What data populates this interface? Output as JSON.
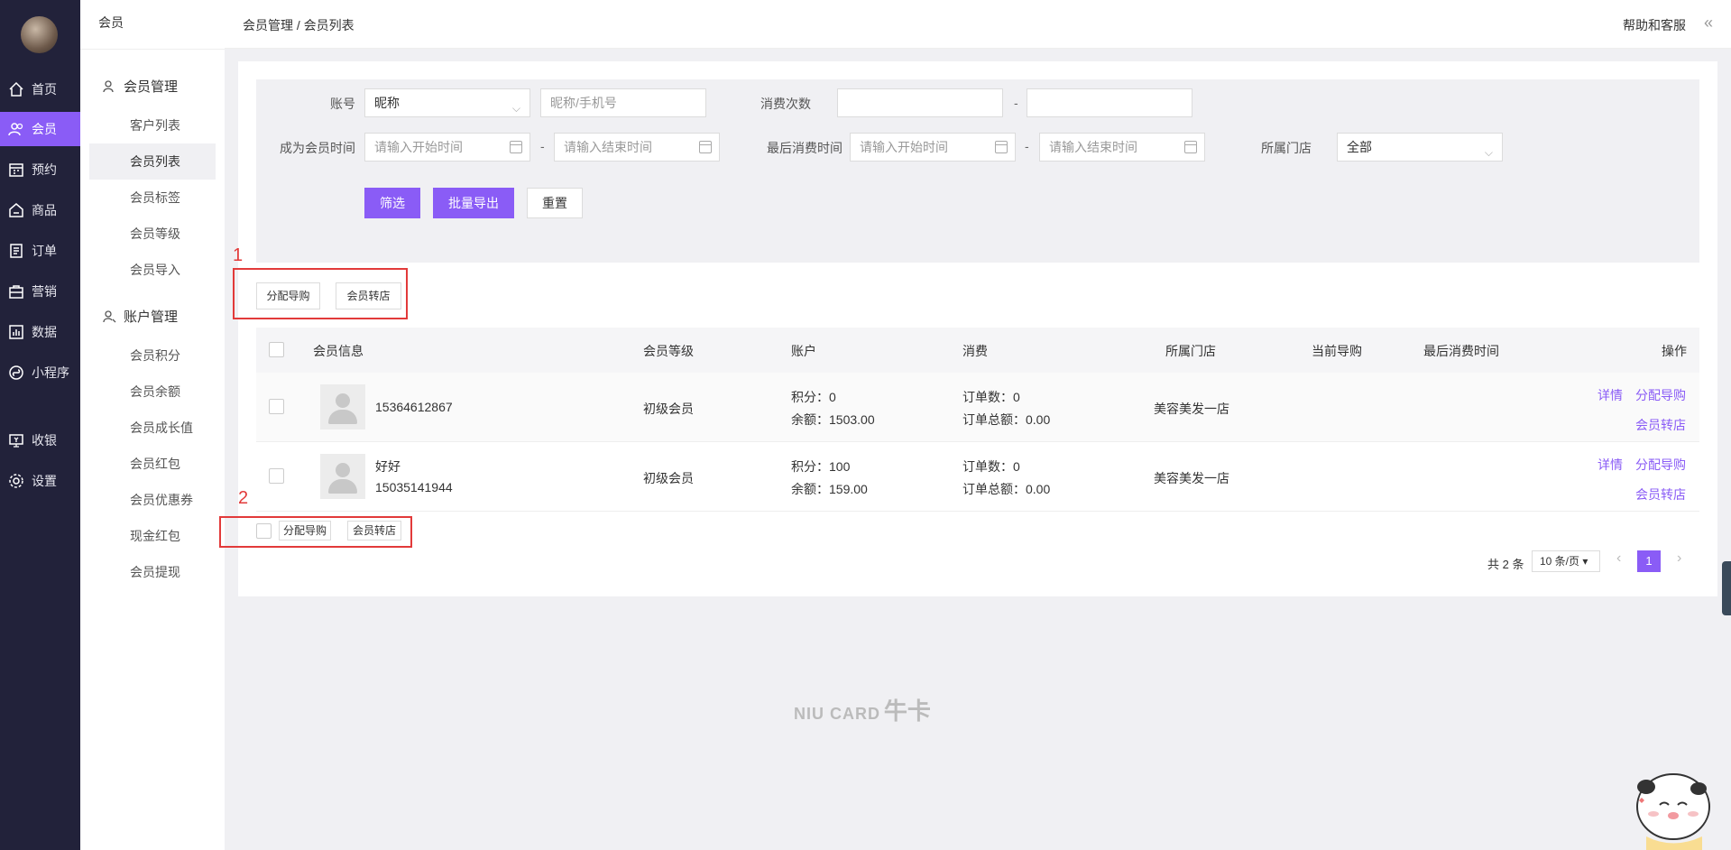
{
  "nav": {
    "items": [
      {
        "label": "首页",
        "icon": "home-icon"
      },
      {
        "label": "会员",
        "icon": "users-icon"
      },
      {
        "label": "预约",
        "icon": "calendar-icon"
      },
      {
        "label": "商品",
        "icon": "goods-icon"
      },
      {
        "label": "订单",
        "icon": "order-icon"
      },
      {
        "label": "营销",
        "icon": "marketing-icon"
      },
      {
        "label": "数据",
        "icon": "chart-icon"
      },
      {
        "label": "小程序",
        "icon": "miniapp-icon"
      },
      {
        "label": "收银",
        "icon": "cashier-icon"
      },
      {
        "label": "设置",
        "icon": "gear-icon"
      }
    ],
    "active_index": 1,
    "accent": "#8a5cf6"
  },
  "subnav": {
    "title": "会员",
    "group1": {
      "label": "会员管理",
      "items": [
        "客户列表",
        "会员列表",
        "会员标签",
        "会员等级",
        "会员导入"
      ]
    },
    "group2": {
      "label": "账户管理",
      "items": [
        "会员积分",
        "会员余额",
        "会员成长值",
        "会员红包",
        "会员优惠券",
        "现金红包",
        "会员提现"
      ]
    },
    "active": "会员列表"
  },
  "topbar": {
    "breadcrumb": "会员管理 / 会员列表",
    "help": "帮助和客服",
    "collapse": "«"
  },
  "filter": {
    "account_label": "账号",
    "account_select": "昵称",
    "account_input_placeholder": "昵称/手机号",
    "consume_count_label": "消费次数",
    "dash": "-",
    "member_time_label": "成为会员时间",
    "start_placeholder": "请输入开始时间",
    "end_placeholder": "请输入结束时间",
    "last_consume_label": "最后消费时间",
    "store_label": "所属门店",
    "store_value": "全部",
    "filter_btn": "筛选",
    "export_btn": "批量导出",
    "reset_btn": "重置"
  },
  "actions": {
    "assign_guide": "分配导购",
    "transfer_store": "会员转店"
  },
  "annotations": {
    "box1": "1",
    "box2": "2"
  },
  "table": {
    "headers": [
      "会员信息",
      "会员等级",
      "账户",
      "消费",
      "所属门店",
      "当前导购",
      "最后消费时间",
      "操作"
    ],
    "rows": [
      {
        "name": "",
        "phone": "15364612867",
        "level": "初级会员",
        "points": "积分：0",
        "balance": "余额：1503.00",
        "orders": "订单数：0",
        "order_total": "订单总额：0.00",
        "store": "美容美发一店",
        "guide": "",
        "last_time": ""
      },
      {
        "name": "好好",
        "phone": "15035141944",
        "level": "初级会员",
        "points": "积分：100",
        "balance": "余额：159.00",
        "orders": "订单数：0",
        "order_total": "订单总额：0.00",
        "store": "美容美发一店",
        "guide": "",
        "last_time": ""
      }
    ],
    "ops": {
      "detail": "详情",
      "assign": "分配导购",
      "transfer": "会员转店"
    }
  },
  "pagination": {
    "total": "共 2 条",
    "page_size": "10 条/页",
    "current": "1",
    "prev": "‹",
    "next": "›"
  },
  "footer_logo": {
    "en": "NIU CARD",
    "cn": "牛卡"
  }
}
